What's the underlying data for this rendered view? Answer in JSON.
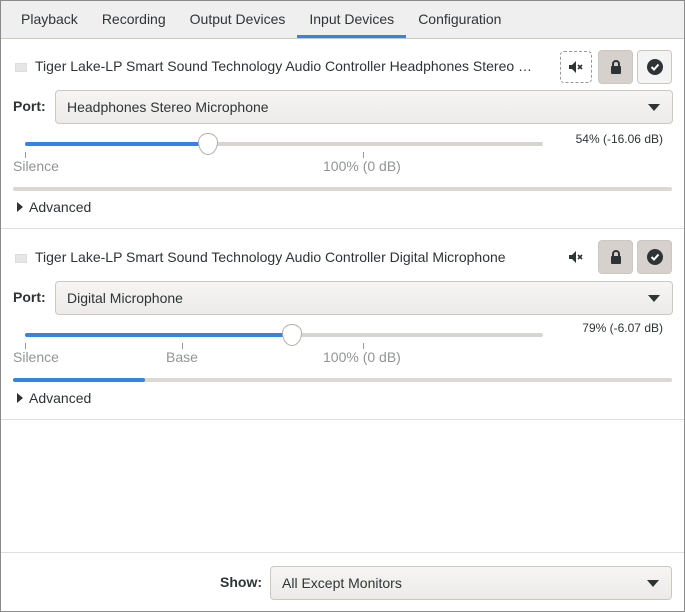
{
  "tabs": [
    {
      "label": "Playback"
    },
    {
      "label": "Recording"
    },
    {
      "label": "Output Devices"
    },
    {
      "label": "Input Devices",
      "active": true
    },
    {
      "label": "Configuration"
    }
  ],
  "devices": [
    {
      "name": "Tiger Lake-LP Smart Sound Technology Audio Controller Headphones Stereo …",
      "port_label": "Port:",
      "port": "Headphones Stereo Microphone",
      "volume_text": "54% (-16.06 dB)",
      "volume_percent": 54,
      "level_percent": 0,
      "marks": {
        "silence": "Silence",
        "full": "100% (0 dB)"
      },
      "advanced": "Advanced",
      "muted": false,
      "locked": true,
      "default": false
    },
    {
      "name": "Tiger Lake-LP Smart Sound Technology Audio Controller Digital Microphone",
      "port_label": "Port:",
      "port": "Digital Microphone",
      "volume_text": "79% (-6.07 dB)",
      "volume_percent": 79,
      "level_percent": 20,
      "marks": {
        "silence": "Silence",
        "base": "Base",
        "full": "100% (0 dB)"
      },
      "advanced": "Advanced",
      "muted": false,
      "locked": true,
      "default": true
    }
  ],
  "footer": {
    "show_label": "Show:",
    "show_value": "All Except Monitors"
  },
  "colors": {
    "accent": "#3584e4"
  }
}
